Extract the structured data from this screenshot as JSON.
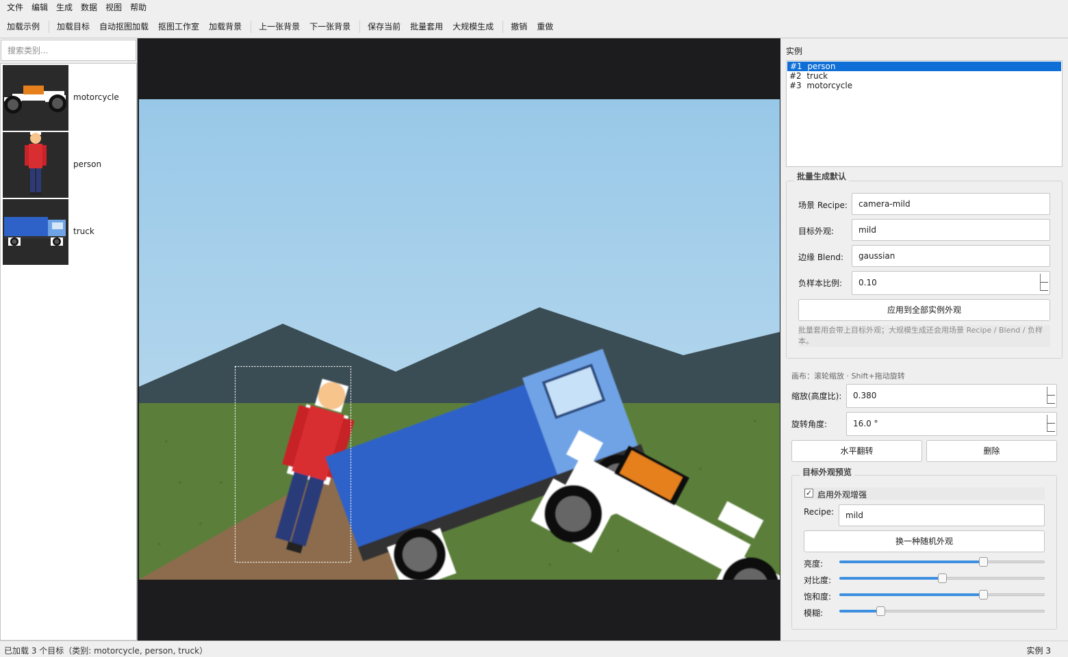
{
  "menu": [
    "文件",
    "编辑",
    "生成",
    "数据",
    "视图",
    "帮助"
  ],
  "toolbar": {
    "groups": [
      [
        "加载示例"
      ],
      [
        "加载目标",
        "自动抠图加载",
        "抠图工作室",
        "加载背景"
      ],
      [
        "上一张背景",
        "下一张背景"
      ],
      [
        "保存当前",
        "批量套用",
        "大规模生成"
      ],
      [
        "撤销",
        "重做"
      ]
    ]
  },
  "left": {
    "search_placeholder": "搜索类别...",
    "categories": [
      {
        "label": "motorcycle",
        "icon": "motorcycle-thumbnail-icon"
      },
      {
        "label": "person",
        "icon": "person-thumbnail-icon"
      },
      {
        "label": "truck",
        "icon": "truck-thumbnail-icon"
      }
    ]
  },
  "right": {
    "instances_title": "实例",
    "instances": [
      "#1  person",
      "#2  truck",
      "#3  motorcycle"
    ],
    "selected_instance": 0,
    "batch": {
      "title": "批量生成默认",
      "scene_recipe_label": "场景 Recipe:",
      "scene_recipe_value": "camera-mild",
      "target_look_label": "目标外观:",
      "target_look_value": "mild",
      "edge_blend_label": "边缘 Blend:",
      "edge_blend_value": "gaussian",
      "neg_ratio_label": "负样本比例:",
      "neg_ratio_value": "0.10",
      "apply_all_label": "应用到全部实例外观",
      "hint": "批量套用会带上目标外观；大规模生成还会用场景 Recipe / Blend / 负样本。"
    },
    "canvas": {
      "hint": "画布：滚轮缩放 · Shift+拖动旋转",
      "scale_label": "缩放(高度比):",
      "scale_value": "0.380",
      "rotation_label": "旋转角度:",
      "rotation_value": "16.0 °",
      "flip_label": "水平翻转",
      "delete_label": "删除"
    },
    "preview": {
      "title": "目标外观预览",
      "enable_label": "启用外观增强",
      "enable_checked": true,
      "check_glyph": "✓",
      "recipe_label": "Recipe:",
      "recipe_value": "mild",
      "random_label": "换一种随机外观",
      "sliders": [
        {
          "label": "亮度:",
          "value": 0.7
        },
        {
          "label": "对比度:",
          "value": 0.5
        },
        {
          "label": "饱和度:",
          "value": 0.7
        },
        {
          "label": "模糊:",
          "value": 0.2
        }
      ]
    }
  },
  "status": {
    "left": "已加载 3 个目标（类别: motorcycle, person, truck）",
    "right": "实例 3"
  },
  "colors": {
    "sky_top": "#98c8e8",
    "sky_bottom": "#bddcef",
    "mountain": "#3b4d54",
    "grass": "#5b7f3a",
    "dirt": "#8c6c4c",
    "person_shirt": "#d82e32",
    "person_pants": "#2c3a7a",
    "truck_body": "#2f62c8",
    "truck_cab": "#6fa3e6",
    "moto_tank": "#e5801c",
    "selection_blue": "#0f6fd6"
  }
}
